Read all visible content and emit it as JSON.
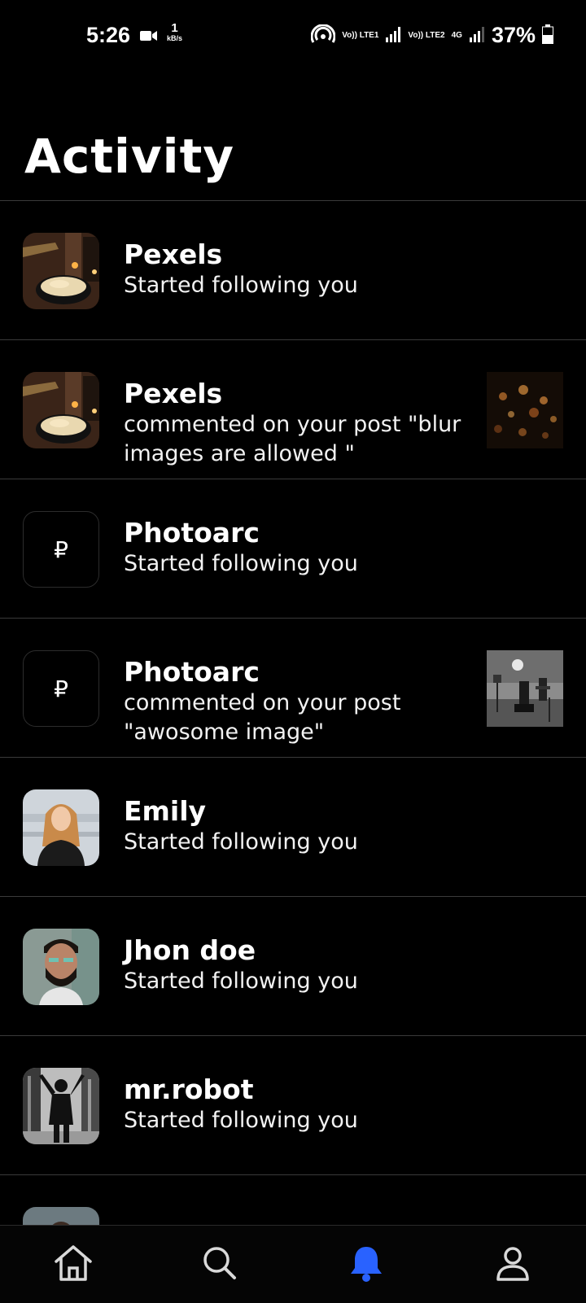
{
  "status_bar": {
    "time": "5:26",
    "speed_value": "1",
    "speed_unit": "kB/s",
    "sim1": "Vo)) LTE1",
    "sim2": "Vo)) LTE2",
    "network": "4G",
    "battery": "37%"
  },
  "page": {
    "title": "Activity"
  },
  "activities": [
    {
      "name": "Pexels",
      "message": "Started following you",
      "avatar": "pexels-food-photo",
      "thumb": null
    },
    {
      "name": "Pexels",
      "message": "commented on your post \"blur images are allowed \"",
      "avatar": "pexels-food-photo",
      "thumb": "bokeh-lights-photo"
    },
    {
      "name": "Photoarc",
      "message": "Started following you",
      "avatar": "photoarc-logo",
      "thumb": null
    },
    {
      "name": "Photoarc",
      "message": "commented on your post \"awosome image\"",
      "avatar": "photoarc-logo",
      "thumb": "photo-studio-photo"
    },
    {
      "name": "Emily",
      "message": "Started following you",
      "avatar": "woman-portrait-photo",
      "thumb": null
    },
    {
      "name": "Jhon doe",
      "message": "Started following you",
      "avatar": "man-portrait-photo",
      "thumb": null
    },
    {
      "name": "mr.robot",
      "message": "Started following you",
      "avatar": "street-bw-photo",
      "thumb": null
    },
    {
      "name": "",
      "message": "",
      "avatar": "partial-portrait-photo",
      "thumb": null
    }
  ],
  "photoarc_logo_glyph": "₽",
  "bottom_nav": [
    {
      "icon": "home-icon",
      "active": false
    },
    {
      "icon": "search-icon",
      "active": false
    },
    {
      "icon": "bell-icon",
      "active": true
    },
    {
      "icon": "profile-icon",
      "active": false
    }
  ],
  "colors": {
    "background": "#000000",
    "accent": "#2962ff",
    "divider": "#3a3a3a",
    "nav_inactive": "#d9d9d9"
  }
}
